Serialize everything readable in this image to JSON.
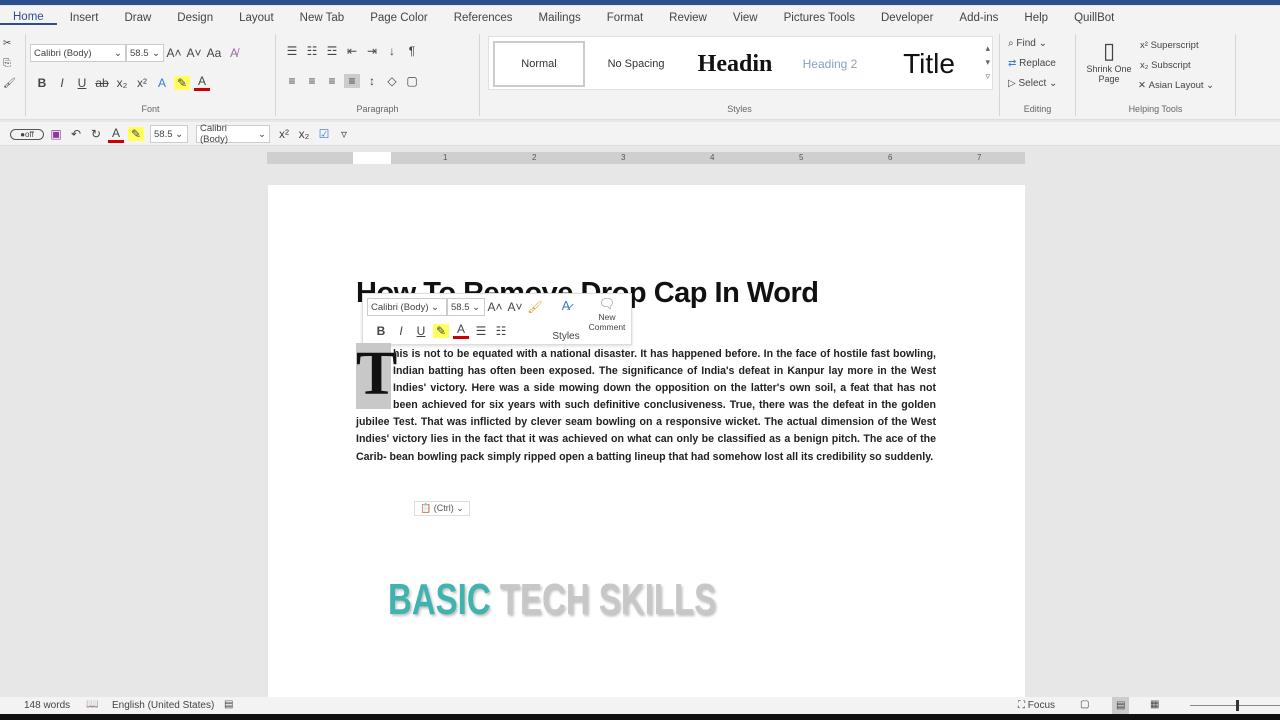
{
  "tabs": [
    "Home",
    "Insert",
    "Draw",
    "Design",
    "Layout",
    "New Tab",
    "Page Color",
    "References",
    "Mailings",
    "Format",
    "Review",
    "View",
    "Pictures Tools",
    "Developer",
    "Add-ins",
    "Help",
    "QuillBot"
  ],
  "font": {
    "name": "Calibri (Body)",
    "size": "58.5",
    "group_label": "Font"
  },
  "paragraph": {
    "group_label": "Paragraph"
  },
  "styles": {
    "group_label": "Styles",
    "items": [
      "Normal",
      "No Spacing",
      "Headin",
      "Heading 2",
      "Title"
    ]
  },
  "editing": {
    "group_label": "Editing",
    "find": "Find",
    "replace": "Replace",
    "select": "Select"
  },
  "helping": {
    "group_label": "Helping Tools",
    "shrink": "Shrink One Page",
    "superscript": "Superscript",
    "subscript": "Subscript",
    "asian_layout": "Asian Layout"
  },
  "qat": {
    "size": "58.5",
    "font": "Calibri (Body)"
  },
  "ruler": [
    "1",
    "2",
    "3",
    "4",
    "5",
    "6",
    "7"
  ],
  "doc": {
    "title": "How To Remove Drop Cap In Word",
    "drop_cap": "T",
    "body": "his is not to be equated with a national disaster. It has happened before. In the face of hostile fast bowling, Indian batting has often been exposed. The significance of India's defeat in Kanpur lay more in the West Indies' victory. Here was a side mowing down the opposition on the latter's own soil, a feat that has not been achieved for six years with such definitive conclusiveness. True, there was the defeat in the golden jubilee Test. That was inflicted by clever seam bowling on a responsive wicket. The actual dimension of the West Indies' victory lies in the fact that it was achieved on what can only be classified as a benign pitch. The ace of the Carib- bean bowling pack simply ripped open a batting lineup that had somehow lost all its credibility so suddenly.",
    "paste_label": "(Ctrl)"
  },
  "mini_toolbar": {
    "font": "Calibri (Body)",
    "size": "58.5",
    "styles": "Styles",
    "new_comment": "New Comment"
  },
  "watermark": {
    "part1": "BASIC",
    "part2": " TECH SKILLS"
  },
  "status": {
    "words": "148 words",
    "language": "English (United States)",
    "focus": "Focus"
  }
}
